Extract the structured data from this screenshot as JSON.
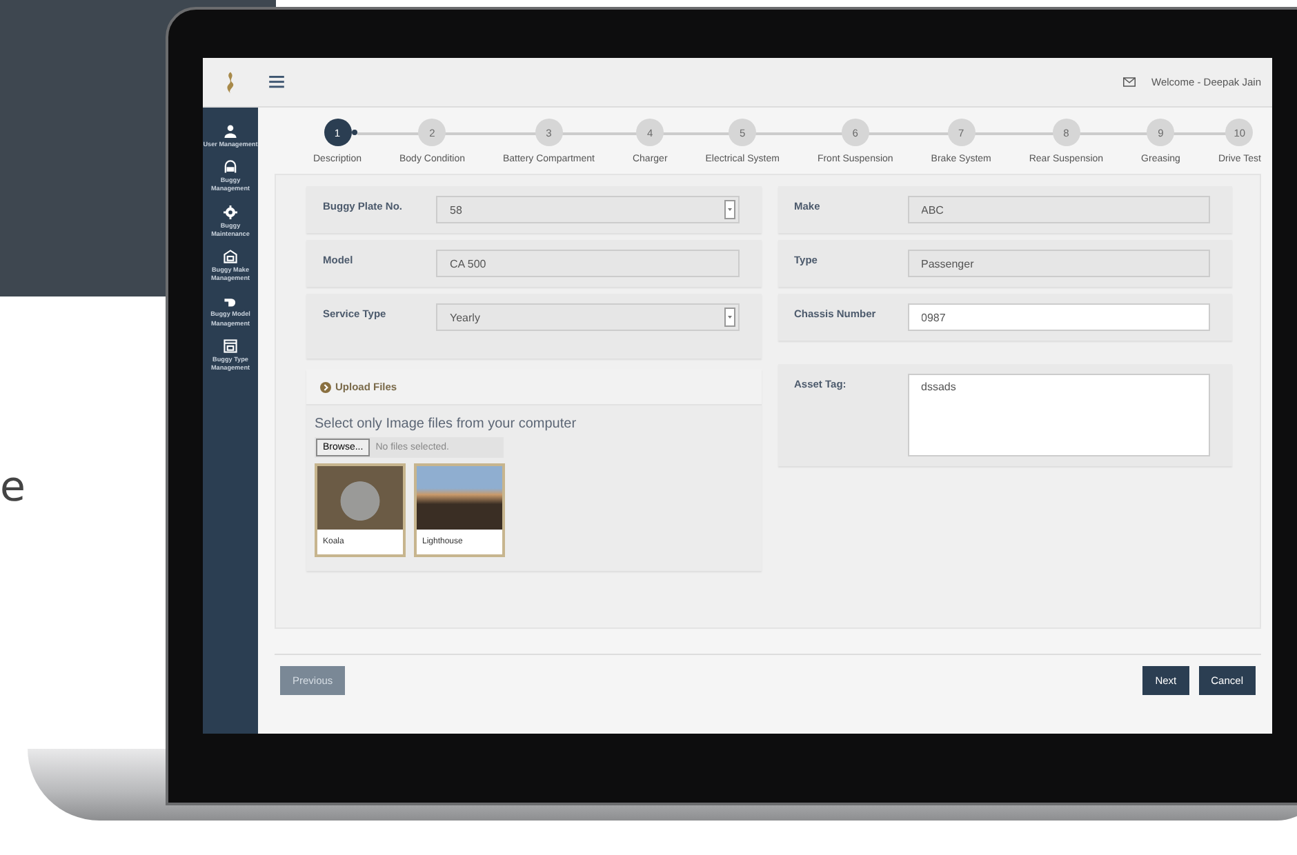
{
  "side_text": "e",
  "header": {
    "welcome": "Welcome - Deepak Jain"
  },
  "sidebar": {
    "items": [
      {
        "label": "User Management",
        "kind": "user"
      },
      {
        "label": "Buggy Management",
        "kind": "buggy"
      },
      {
        "label": "Buggy Maintenance",
        "kind": "gear"
      },
      {
        "label": "Buggy Make Management",
        "kind": "garage"
      },
      {
        "label": "Buggy Model Management",
        "kind": "hand"
      },
      {
        "label": "Buggy Type Management",
        "kind": "garage2"
      }
    ]
  },
  "steps": [
    {
      "number": "1",
      "label": "Description",
      "selected": true
    },
    {
      "number": "2",
      "label": "Body Condition",
      "selected": false
    },
    {
      "number": "3",
      "label": "Battery Compartment",
      "selected": false
    },
    {
      "number": "4",
      "label": "Charger",
      "selected": false
    },
    {
      "number": "5",
      "label": "Electrical System",
      "selected": false
    },
    {
      "number": "6",
      "label": "Front Suspension",
      "selected": false
    },
    {
      "number": "7",
      "label": "Brake System",
      "selected": false
    },
    {
      "number": "8",
      "label": "Rear Suspension",
      "selected": false
    },
    {
      "number": "9",
      "label": "Greasing",
      "selected": false
    },
    {
      "number": "10",
      "label": "Drive Test",
      "selected": false
    }
  ],
  "form": {
    "left": [
      {
        "label": "Buggy Plate No.",
        "kind": "select",
        "value": "58",
        "disabled": true
      },
      {
        "label": "Model",
        "kind": "text",
        "value": "CA 500",
        "disabled": true
      },
      {
        "label": "Service Type",
        "kind": "select",
        "value": "Yearly",
        "disabled": true
      }
    ],
    "upload": {
      "title": "Upload Files",
      "hint": "Select only Image files from your computer",
      "browse": "Browse...",
      "status": "No files selected.",
      "images": [
        {
          "caption": "Koala",
          "kind": "koala"
        },
        {
          "caption": "Lighthouse",
          "kind": "lighthouse"
        }
      ]
    },
    "right": [
      {
        "label": "Make",
        "kind": "text",
        "value": "ABC",
        "disabled": true
      },
      {
        "label": "Type",
        "kind": "text",
        "value": "Passenger",
        "disabled": true
      },
      {
        "label": "Chassis Number",
        "kind": "text",
        "value": "0987",
        "disabled": false
      },
      {
        "label": "Asset Tag:",
        "kind": "textarea",
        "value": "dssads",
        "disabled": false
      }
    ]
  },
  "footer": {
    "previous": {
      "label": "Previous",
      "disabled": true
    },
    "actions": [
      {
        "label": "Next",
        "disabled": false
      },
      {
        "label": "Cancel",
        "disabled": false
      }
    ]
  }
}
